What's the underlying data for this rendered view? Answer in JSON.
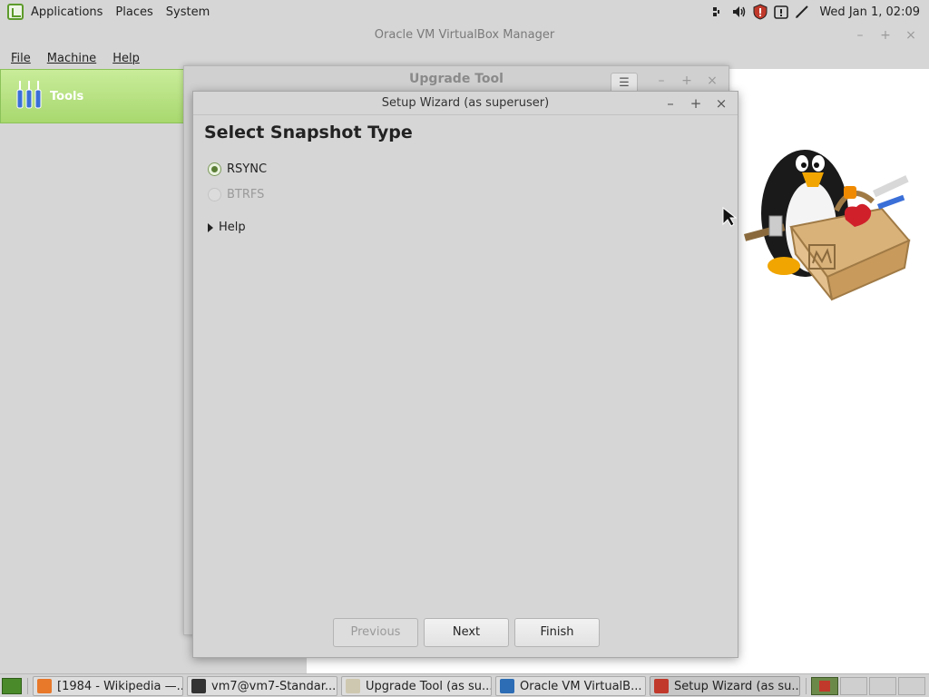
{
  "top_panel": {
    "menus": [
      "Applications",
      "Places",
      "System"
    ],
    "clock": "Wed Jan  1, 02:09"
  },
  "vbox": {
    "title": "Oracle VM VirtualBox Manager",
    "menubar": [
      "File",
      "Machine",
      "Help"
    ],
    "tools_label": "Tools"
  },
  "upgrade_tool": {
    "title": "Upgrade Tool"
  },
  "wizard": {
    "title": "Setup Wizard (as superuser)",
    "heading": "Select Snapshot Type",
    "options": [
      {
        "label": "RSYNC",
        "selected": true,
        "enabled": true
      },
      {
        "label": "BTRFS",
        "selected": false,
        "enabled": false
      }
    ],
    "help_label": "Help",
    "buttons": {
      "previous": "Previous",
      "next": "Next",
      "finish": "Finish"
    }
  },
  "taskbar": {
    "items": [
      {
        "label": "[1984 - Wikipedia —...",
        "icon": "firefox-icon"
      },
      {
        "label": "vm7@vm7-Standar...",
        "icon": "terminal-icon"
      },
      {
        "label": "Upgrade Tool (as su...",
        "icon": "upgrade-icon"
      },
      {
        "label": "Oracle VM VirtualB...",
        "icon": "virtualbox-icon"
      },
      {
        "label": "Setup Wizard (as su...",
        "icon": "setup-icon"
      }
    ]
  },
  "colors": {
    "accent_green": "#a8d86e",
    "panel_gray": "#d6d6d6"
  }
}
